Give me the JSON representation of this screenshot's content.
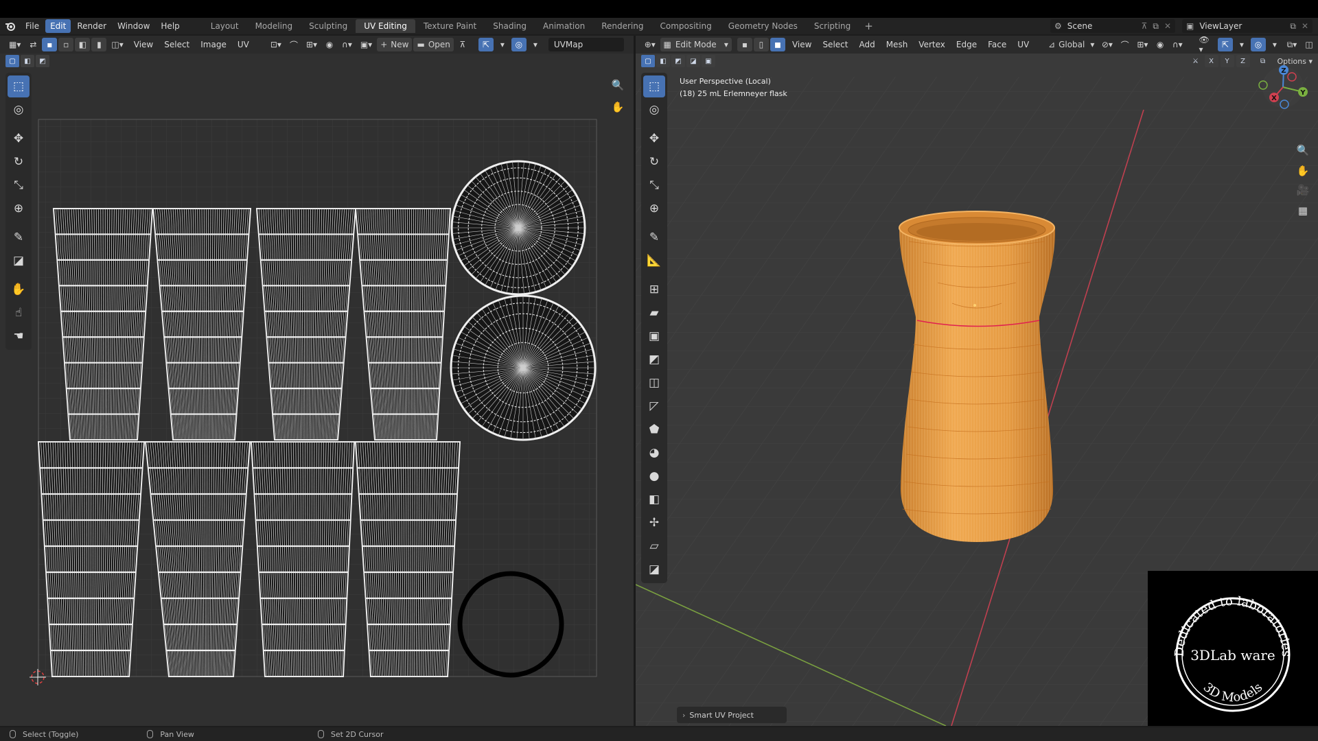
{
  "top_menu": {
    "items": [
      "File",
      "Edit",
      "Render",
      "Window",
      "Help"
    ],
    "active": "Edit"
  },
  "workspaces": {
    "tabs": [
      "Layout",
      "Modeling",
      "Sculpting",
      "UV Editing",
      "Texture Paint",
      "Shading",
      "Animation",
      "Rendering",
      "Compositing",
      "Geometry Nodes",
      "Scripting"
    ],
    "active": "UV Editing",
    "add_label": "+"
  },
  "scene": {
    "name": "Scene"
  },
  "view_layer": {
    "name": "ViewLayer"
  },
  "uv_editor": {
    "menus": [
      "View",
      "Select",
      "Image",
      "UV"
    ],
    "new_label": "New",
    "open_label": "Open",
    "uv_map": "UVMap"
  },
  "viewport": {
    "mode": "Edit Mode",
    "menus": [
      "View",
      "Select",
      "Add",
      "Mesh",
      "Vertex",
      "Edge",
      "Face",
      "UV"
    ],
    "orientation": "Global",
    "options_label": "Options",
    "axis_labels": [
      "X",
      "Y",
      "Z"
    ],
    "info_line1": "User Perspective (Local)",
    "info_line2": "(18) 25 mL Erlemneyer flask",
    "redo_panel": "Smart UV Project"
  },
  "status_bar": {
    "items": [
      "Select (Toggle)",
      "Pan View",
      "Set 2D Cursor"
    ]
  },
  "watermark": {
    "top_text": "Dedicated to laboratories",
    "center_text": "3DLab ware",
    "bottom_text": "3D Models"
  },
  "colors": {
    "accent": "#4772b3",
    "mesh_orange": "#e8a04a",
    "seam_red": "#e02050",
    "axis_x": "#c04050",
    "axis_y": "#7aa040"
  }
}
